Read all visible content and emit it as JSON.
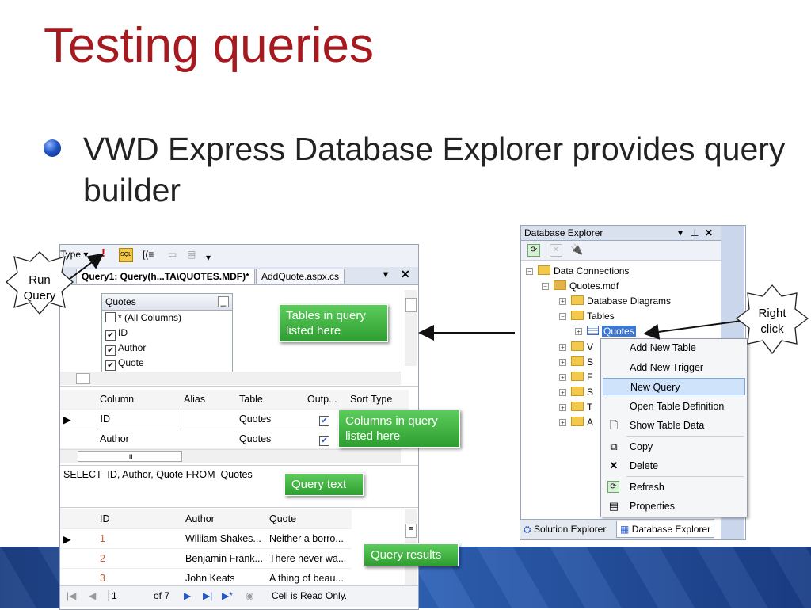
{
  "slide": {
    "title": "Testing queries",
    "bullet": "VWD Express Database Explorer provides query builder"
  },
  "query_builder": {
    "toolbar_type_label": "Type",
    "tabs": [
      {
        "label": "Query1: Query(h...TA\\QUOTES.MDF)*",
        "active": true
      },
      {
        "label": "AddQuote.aspx.cs",
        "active": false
      }
    ],
    "table_box": {
      "title": "Quotes",
      "columns": [
        {
          "label": "* (All Columns)",
          "checked": false
        },
        {
          "label": "ID",
          "checked": true
        },
        {
          "label": "Author",
          "checked": true
        },
        {
          "label": "Quote",
          "checked": true
        }
      ]
    },
    "criteria_headers": [
      "Column",
      "Alias",
      "Table",
      "Outp...",
      "Sort Type"
    ],
    "criteria_rows": [
      {
        "column": "ID",
        "alias": "",
        "table": "Quotes",
        "output": true
      },
      {
        "column": "Author",
        "alias": "",
        "table": "Quotes",
        "output": true
      }
    ],
    "scroll_marker": "III",
    "sql": "SELECT  ID, Author, Quote FROM  Quotes",
    "results_headers": [
      "ID",
      "Author",
      "Quote"
    ],
    "results_rows": [
      {
        "id": "1",
        "author": "William Shakes...",
        "quote": "Neither a borro..."
      },
      {
        "id": "2",
        "author": "Benjamin Frank...",
        "quote": "There never wa..."
      },
      {
        "id": "3",
        "author": "John Keats",
        "quote": "A thing of beau..."
      }
    ],
    "status": {
      "record": "1",
      "of_total": "of 7",
      "message": "Cell is Read Only."
    }
  },
  "callouts": {
    "tables": "Tables in query listed here",
    "columns": "Columns in query listed here",
    "query_text": "Query text",
    "query_results": "Query results"
  },
  "bursts": {
    "run_query": "Run Query",
    "right_click": "Right click"
  },
  "db_explorer": {
    "title": "Database Explorer",
    "tree": {
      "root": "Data Connections",
      "db": "Quotes.mdf",
      "folders": [
        "Database Diagrams",
        "Tables"
      ],
      "selected_table": "Quotes",
      "collapsed_initials": [
        "V",
        "S",
        "F",
        "S",
        "T",
        "A"
      ]
    },
    "context_menu": [
      {
        "label": "Add New Table",
        "icon": ""
      },
      {
        "label": "Add New Trigger",
        "icon": ""
      },
      {
        "label": "New Query",
        "icon": "",
        "highlighted": true
      },
      {
        "label": "Open Table Definition",
        "icon": ""
      },
      {
        "label": "Show Table Data",
        "icon": "document-icon"
      },
      {
        "label": "Copy",
        "icon": "copy-icon"
      },
      {
        "label": "Delete",
        "icon": "delete-icon"
      },
      {
        "label": "Refresh",
        "icon": "refresh-icon"
      },
      {
        "label": "Properties",
        "icon": "properties-icon"
      }
    ],
    "footer_tabs": [
      "Solution Explorer",
      "Database Explorer"
    ]
  },
  "colors": {
    "title": "#a6191e",
    "callout": "#3fb340",
    "highlight": "#cfe3fb",
    "band": "#2a57a8"
  }
}
